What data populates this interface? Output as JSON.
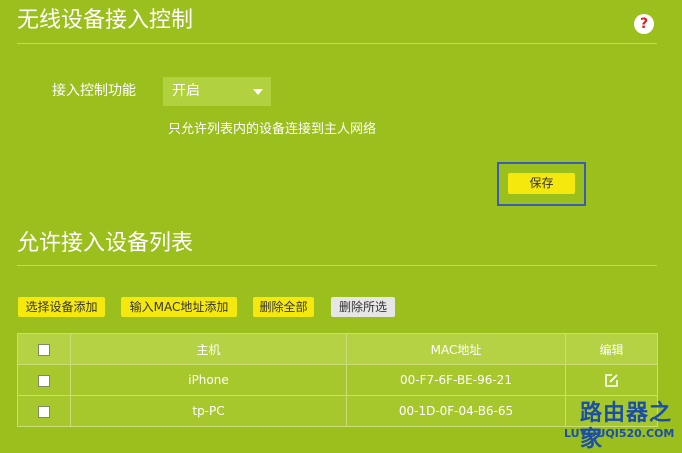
{
  "page": {
    "title": "无线设备接入控制",
    "help_icon": "question-circle-icon"
  },
  "access_control": {
    "label": "接入控制功能",
    "selected_value": "开启",
    "hint": "只允许列表内的设备连接到主人网络",
    "save_label": "保存"
  },
  "allowed_list": {
    "title": "允许接入设备列表",
    "toolbar": {
      "select_add": "选择设备添加",
      "mac_add": "输入MAC地址添加",
      "delete_all": "删除全部",
      "delete_selected": "删除所选"
    },
    "columns": {
      "host": "主机",
      "mac": "MAC地址",
      "edit": "编辑"
    },
    "rows": [
      {
        "host": "iPhone",
        "mac": "00-F7-6F-BE-96-21"
      },
      {
        "host": "tp-PC",
        "mac": "00-1D-0F-04-B6-65"
      }
    ]
  },
  "watermark": {
    "text": "路由器之家",
    "url": "LUYOUQI520.COM"
  },
  "colors": {
    "background": "#9bbf1c",
    "button_yellow": "#f5e80c",
    "button_gray": "#e6e6e6",
    "save_focus_border": "#3a5bb8",
    "help_icon_red": "#e02020"
  }
}
